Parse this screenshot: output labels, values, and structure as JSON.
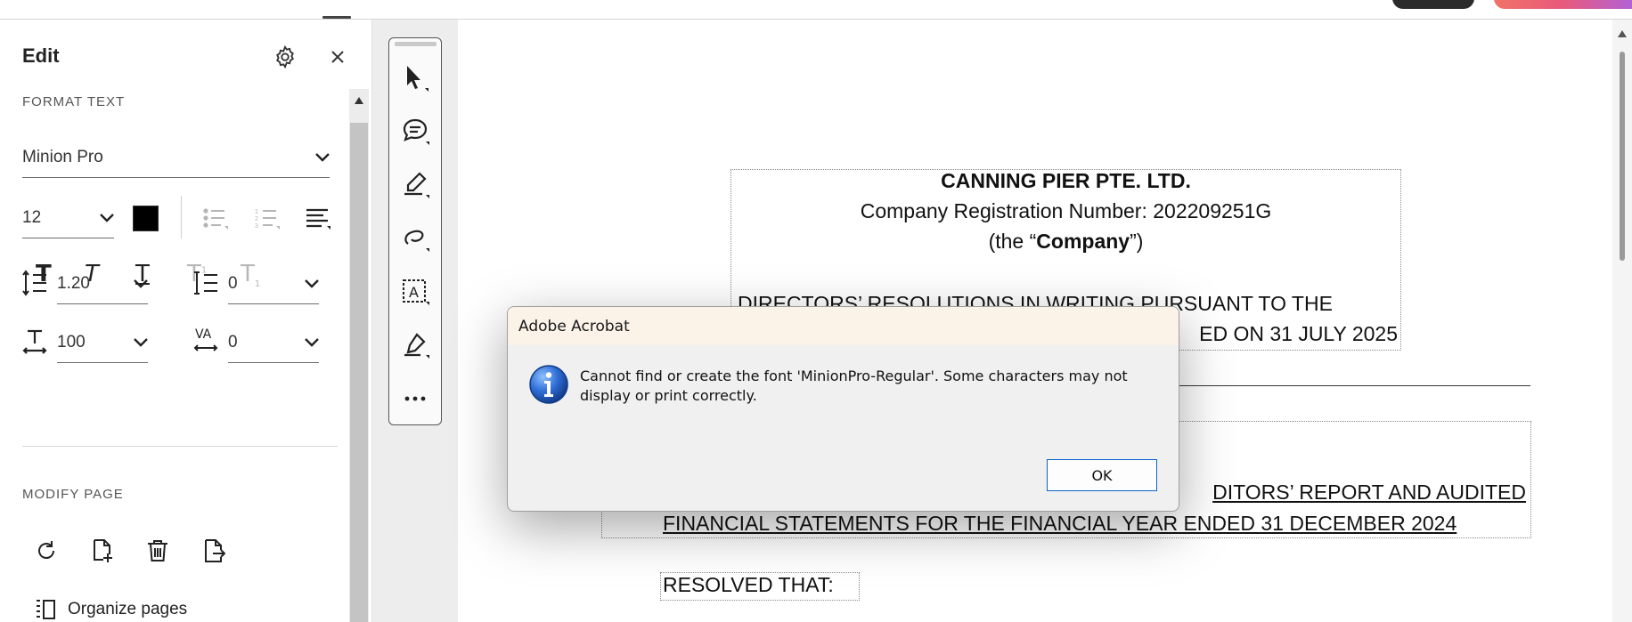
{
  "panel": {
    "title": "Edit",
    "format_section": "FORMAT TEXT",
    "font_family": "Minion Pro",
    "font_size": "12",
    "line_spacing": "1.20",
    "paragraph_spacing": "0",
    "horizontal_scale": "100",
    "char_spacing": "0",
    "modify_section": "MODIFY PAGE",
    "organize_label": "Organize pages"
  },
  "document": {
    "company_name": "CANNING PIER PTE. LTD.",
    "reg_line": "Company Registration Number: 202209251G",
    "the_prefix": "(the “",
    "company_word": "Company",
    "the_suffix": "”)",
    "resolutions_line1": "DIRECTORS’ RESOLUTIONS IN WRITING PURSUANT TO THE",
    "resolutions_line2": "ED ON 31 JULY 2025",
    "report_line1": "DITORS’  REPORT  AND  AUDITED",
    "report_line2": "FINANCIAL STATEMENTS FOR THE FINANCIAL YEAR ENDED 31 DECEMBER 2024",
    "resolved": "RESOLVED THAT:"
  },
  "dialog": {
    "title": "Adobe Acrobat",
    "message": "Cannot find or create the font 'MinionPro-Regular'. Some characters may not display or print correctly.",
    "ok_label": "OK",
    "icon": "info-icon"
  },
  "colors": {
    "text_color_swatch": "#000000",
    "dialog_ok_border": "#0a64c8",
    "dialog_title_bg": "#fbf2e8"
  }
}
